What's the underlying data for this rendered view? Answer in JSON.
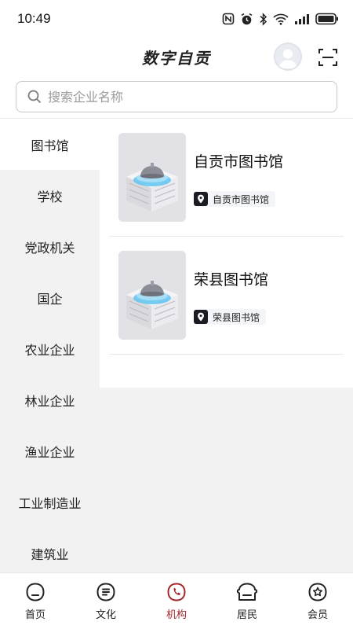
{
  "status_bar": {
    "time": "10:49"
  },
  "header": {
    "title": "数字自贡"
  },
  "search": {
    "placeholder": "搜索企业名称",
    "value": ""
  },
  "sidebar": {
    "items": [
      {
        "label": "图书馆",
        "active": true
      },
      {
        "label": "学校"
      },
      {
        "label": "党政机关"
      },
      {
        "label": "国企"
      },
      {
        "label": "农业企业"
      },
      {
        "label": "林业企业"
      },
      {
        "label": "渔业企业"
      },
      {
        "label": "工业制造业"
      },
      {
        "label": "建筑业"
      }
    ]
  },
  "organizations": [
    {
      "name": "自贡市图书馆",
      "tag": "自贡市图书馆"
    },
    {
      "name": "荣县图书馆",
      "tag": "荣县图书馆"
    }
  ],
  "tab_bar": {
    "tabs": [
      {
        "label": "首页",
        "icon": "home-icon"
      },
      {
        "label": "文化",
        "icon": "culture-icon"
      },
      {
        "label": "机构",
        "icon": "institution-icon",
        "active": true
      },
      {
        "label": "居民",
        "icon": "resident-icon"
      },
      {
        "label": "会员",
        "icon": "member-icon"
      }
    ]
  },
  "colors": {
    "accent": "#a3262b",
    "sidebar_bg": "#f2f2f2",
    "tag_icon_bg": "#1b1b24"
  }
}
